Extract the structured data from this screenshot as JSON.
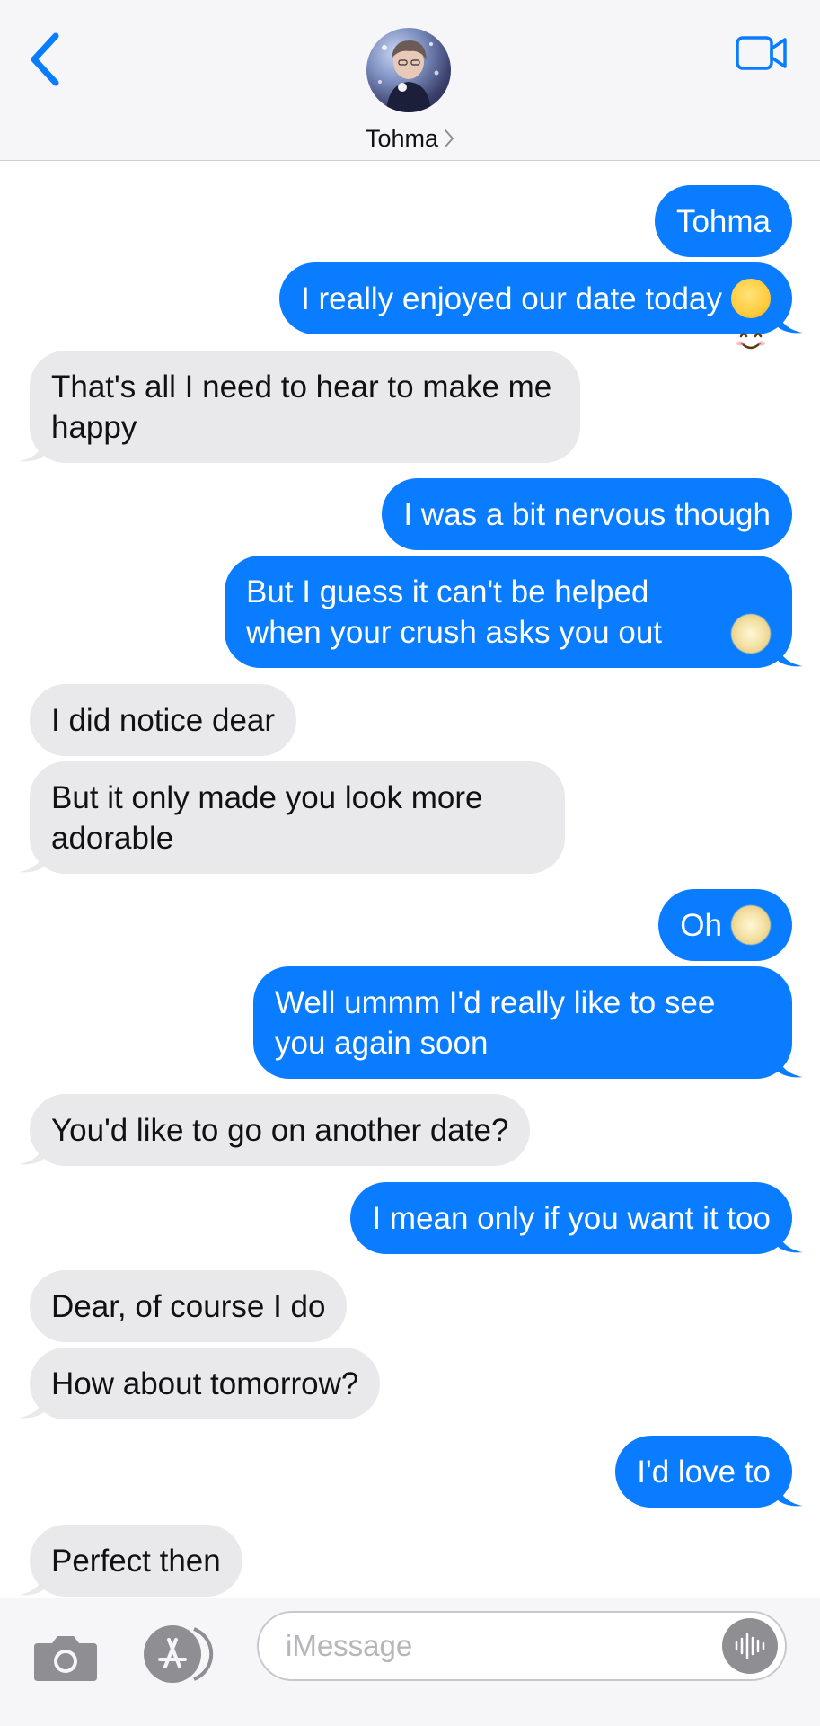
{
  "header": {
    "contact_name": "Tohma",
    "accent_color": "#0a7cff"
  },
  "messages": [
    {
      "from": "me",
      "text": "Tohma"
    },
    {
      "from": "me",
      "text": "I really enjoyed our date today",
      "emoji": "smiling-face-emoji"
    },
    {
      "from": "them",
      "text": "That's all I need to hear to make me happy"
    },
    {
      "from": "me",
      "text": "I was a bit nervous though"
    },
    {
      "from": "me",
      "text": "But I guess it can't be helped when your crush asks you out",
      "emoji": "blurred-emoji"
    },
    {
      "from": "them",
      "text": "I did notice dear"
    },
    {
      "from": "them",
      "text": "But it only made you look more adorable"
    },
    {
      "from": "me",
      "text": "Oh",
      "emoji": "blurred-emoji"
    },
    {
      "from": "me",
      "text": "Well ummm I'd really like to see you again soon"
    },
    {
      "from": "them",
      "text": "You'd like to go on another date?"
    },
    {
      "from": "me",
      "text": "I mean only if you want it too"
    },
    {
      "from": "them",
      "text": "Dear, of course I do"
    },
    {
      "from": "them",
      "text": "How about tomorrow?"
    },
    {
      "from": "me",
      "text": "I'd love to"
    },
    {
      "from": "them",
      "text": "Perfect then"
    }
  ],
  "compose": {
    "placeholder": "iMessage",
    "value": ""
  },
  "colors": {
    "outgoing_bubble": "#0a7cff",
    "incoming_bubble": "#e9e9eb"
  },
  "icons": [
    "back-chevron-icon",
    "video-camera-icon",
    "camera-icon",
    "app-store-icon",
    "audio-waveform-icon"
  ]
}
